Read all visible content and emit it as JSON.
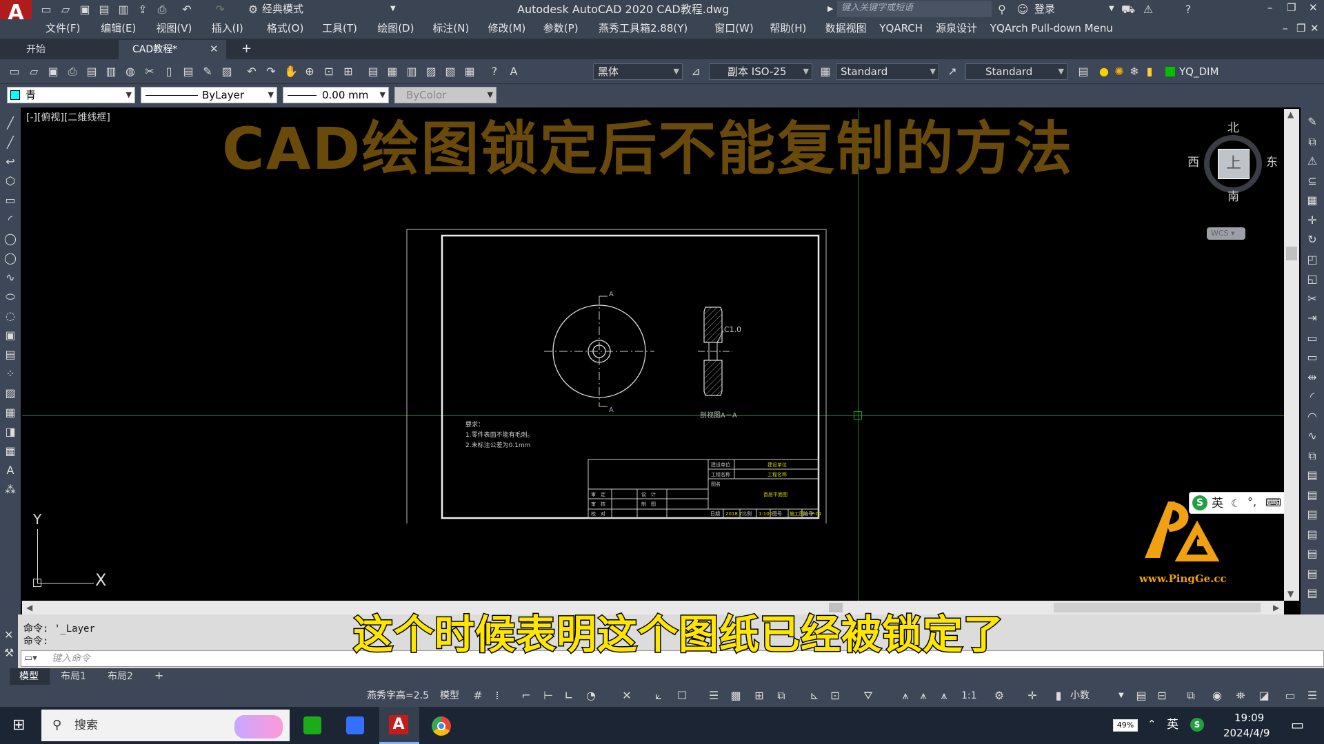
{
  "titlebar": {
    "workspace": "经典模式",
    "title": "Autodesk AutoCAD 2020    CAD教程.dwg",
    "search_placeholder": "键入关键字或短语",
    "login": "登录"
  },
  "menu": [
    "文件(F)",
    "编辑(E)",
    "视图(V)",
    "插入(I)",
    "格式(O)",
    "工具(T)",
    "绘图(D)",
    "标注(N)",
    "修改(M)",
    "参数(P)",
    "燕秀工具箱2.88(Y)",
    "窗口(W)",
    "帮助(H)",
    "数据视图",
    "YQARCH",
    "源泉设计",
    "YQArch Pull-down Menu"
  ],
  "tabs": {
    "start": "开始",
    "doc": "CAD教程*",
    "add": "+"
  },
  "toolbar1": {
    "font": "黑体",
    "dim_style": "副本 ISO-25",
    "table_style": "Standard",
    "mleader_style": "Standard",
    "layer": "YQ_DIM"
  },
  "toolbar2": {
    "color": "青",
    "linetype": "ByLayer",
    "lineweight": "0.00 mm",
    "plotstyle": "ByColor"
  },
  "viewport_label": "[-][俯视][二维线框]",
  "overlay_title": "CAD绘图锁定后不能复制的方法",
  "viewcube": {
    "n": "北",
    "s": "南",
    "e": "东",
    "w": "西",
    "face": "上",
    "wcs": "WCS"
  },
  "drawing": {
    "dim_c": "C1.0",
    "label_a": "A",
    "section": "剖视图A－A",
    "notes": [
      "要求：",
      "1.零件表面不能有毛刺。",
      "2.未标注公差为0.1mm"
    ],
    "titleblock": {
      "r1": [
        "建设单位",
        "建设单位"
      ],
      "r2": [
        "工程名称",
        "工程名称"
      ],
      "r3": [
        "图名",
        "首层平面图"
      ],
      "left": [
        [
          "审　定",
          "设　计"
        ],
        [
          "审　核",
          "制　图"
        ],
        [
          "校　对",
          ""
        ]
      ],
      "bottom": [
        "日期",
        "2018.7",
        "比例",
        "1:100",
        "图号",
        "施工图",
        "编号",
        "P-01"
      ]
    }
  },
  "ucs": {
    "y": "Y",
    "x": "X"
  },
  "watermark": {
    "url": "www.PingGe.cc"
  },
  "ime": {
    "lang": "英"
  },
  "command": {
    "line1": "命令: '_Layer",
    "line2": "命令:",
    "placeholder": "键入命令"
  },
  "subtitle": "这个时候表明这个图纸已经被锁定了",
  "layouts": [
    "模型",
    "布局1",
    "布局2",
    "+"
  ],
  "status": {
    "textheight": "燕秀字高=2.5",
    "model": "模型",
    "scale": "1:1",
    "units": "小数"
  },
  "taskbar": {
    "search": "搜索",
    "battery": "49%",
    "lang": "英",
    "time": "19:09",
    "date": "2024/4/9"
  },
  "colors": {
    "accent": "#00ffff",
    "title_overlay": "#6a4a0a",
    "subtitle": "#ffe600",
    "titlebar": "#3b4453",
    "logo": "#f0a010"
  }
}
